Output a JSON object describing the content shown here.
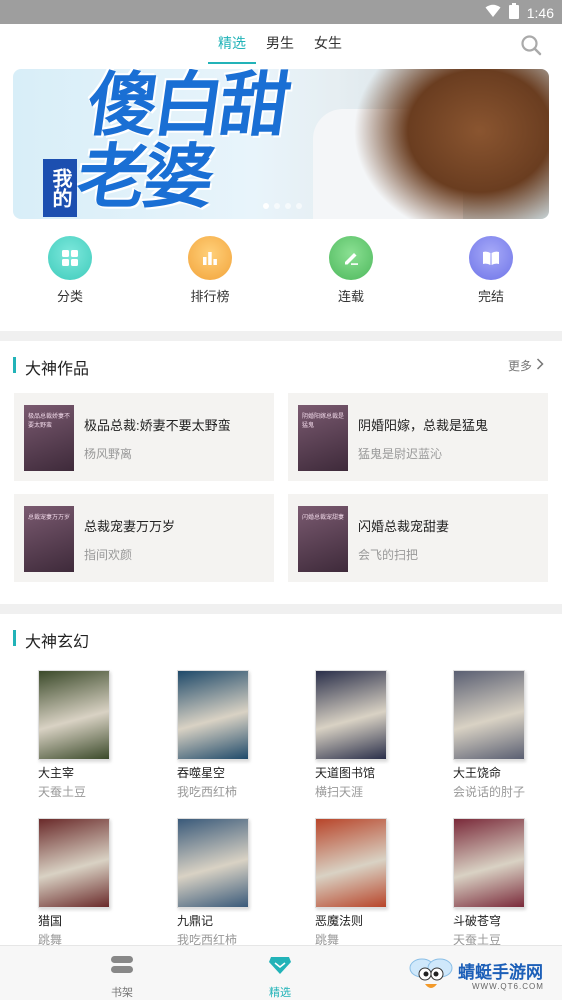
{
  "status_bar": {
    "time": "1:46"
  },
  "top_tabs": [
    {
      "label": "精选",
      "active": true
    },
    {
      "label": "男生",
      "active": false
    },
    {
      "label": "女生",
      "active": false
    }
  ],
  "banner": {
    "title_line1": "傻白甜",
    "title_line2": "老婆",
    "tag": "我的",
    "page_count": 4,
    "current_page": 1
  },
  "quick_nav": [
    {
      "label": "分类",
      "icon": "grid-icon",
      "color": "#4fd6c8"
    },
    {
      "label": "排行榜",
      "icon": "bar-chart-icon",
      "color": "#f6b24a"
    },
    {
      "label": "连载",
      "icon": "pen-icon",
      "color": "#5cc86c"
    },
    {
      "label": "完结",
      "icon": "book-open-icon",
      "color": "#7f86f0"
    }
  ],
  "section_authors": {
    "title": "大神作品",
    "more": "更多",
    "books": [
      {
        "title": "极品总裁:娇妻不要太野蛮",
        "author": "杨风野离",
        "cover_text": "极品总裁娇妻不要太野蛮"
      },
      {
        "title": "阴婚阳嫁，总裁是猛鬼",
        "author": "猛鬼是尉迟蓝沁",
        "cover_text": "阴婚阳嫁总裁是猛鬼"
      },
      {
        "title": "总裁宠妻万万岁",
        "author": "指间欢颜",
        "cover_text": "总裁宠妻万万岁"
      },
      {
        "title": "闪婚总裁宠甜妻",
        "author": "会飞的扫把",
        "cover_text": "闪婚总裁宠甜妻"
      }
    ]
  },
  "section_fantasy": {
    "title": "大神玄幻",
    "books": [
      {
        "title": "大主宰",
        "author": "天蚕土豆",
        "cover_color": "#3b4a2a"
      },
      {
        "title": "吞噬星空",
        "author": "我吃西红柿",
        "cover_color": "#1f4a6a"
      },
      {
        "title": "天道图书馆",
        "author": "横扫天涯",
        "cover_color": "#2a2f4a"
      },
      {
        "title": "大王饶命",
        "author": "会说话的肘子",
        "cover_color": "#5a5f72"
      },
      {
        "title": "猎国",
        "author": "跳舞",
        "cover_color": "#6a2a2a"
      },
      {
        "title": "九鼎记",
        "author": "我吃西红柿",
        "cover_color": "#3a5a7a"
      },
      {
        "title": "恶魔法则",
        "author": "跳舞",
        "cover_color": "#b8452a"
      },
      {
        "title": "斗破苍穹",
        "author": "天蚕土豆",
        "cover_color": "#7a2a3a"
      }
    ]
  },
  "bottom_nav": [
    {
      "label": "书架",
      "icon": "bookshelf-icon",
      "active": false
    },
    {
      "label": "精选",
      "icon": "diamond-icon",
      "active": true
    }
  ],
  "watermark": {
    "text": "蜻蜓手游网",
    "sub": "WWW.QT6.COM"
  },
  "colors": {
    "accent": "#22b3b8"
  }
}
